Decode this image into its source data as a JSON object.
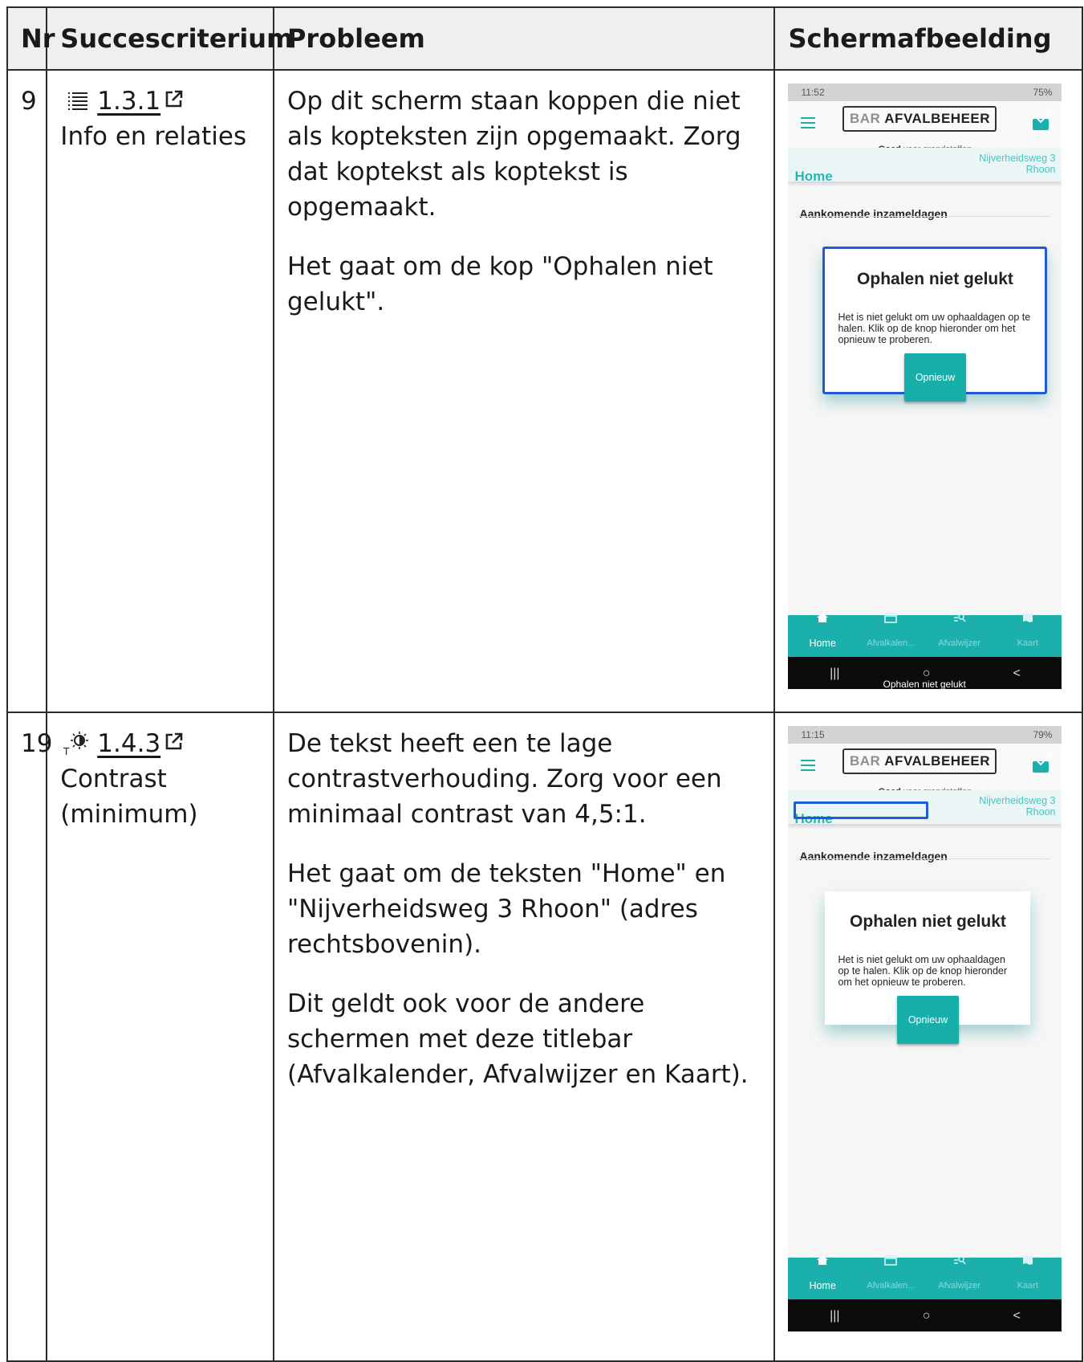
{
  "table": {
    "headers": [
      "Nr",
      "Succescriterium",
      "Probleem",
      "Schermafbeelding"
    ],
    "rows": [
      {
        "nr": "9",
        "criterion_icon": "list-icon",
        "criterion_code": "1.3.1",
        "criterion_name": "Info en relaties",
        "problem": [
          "Op dit scherm staan koppen die niet als kopteksten zijn opgemaakt. Zorg dat koptekst als koptekst is opgemaakt.",
          "Het gaat om de kop \"Ophalen niet gelukt\"."
        ],
        "screenshot": {
          "time": "11:52",
          "battery": "75%",
          "logo_bar": "BAR",
          "logo_name": "AFVALBEHEER",
          "tagline_bold": "Goed",
          "tagline_rest": "voor grondstoffen",
          "title": "Home",
          "address_line1": "Nijverheidsweg 3",
          "address_line2": "Rhoon",
          "section": "Aankomende inzameldagen",
          "dialog_title": "Ophalen niet gelukt",
          "dialog_body": "Het is niet gelukt om uw ophaaldagen op te halen. Klik op de knop hieronder om het opnieuw te proberen.",
          "dialog_button": "Opnieuw",
          "nav": [
            "Home",
            "Afvalkalen...",
            "Afvalwijzer",
            "Kaart"
          ],
          "caption": "Ophalen niet gelukt"
        }
      },
      {
        "nr": "19",
        "criterion_icon": "contrast-icon",
        "criterion_code": "1.4.3",
        "criterion_name_line1": "Contrast",
        "criterion_name_line2": "(minimum)",
        "problem": [
          "De tekst heeft een te lage contrastverhouding. Zorg voor een minimaal contrast van 4,5:1.",
          "Het gaat om de teksten \"Home\" en \"Nijverheidsweg 3 Rhoon\" (adres rechtsbovenin).",
          "Dit geldt ook voor de andere schermen met deze titlebar (Afvalkalender, Afvalwijzer en Kaart)."
        ],
        "screenshot": {
          "time": "11:15",
          "battery": "79%",
          "logo_bar": "BAR",
          "logo_name": "AFVALBEHEER",
          "tagline_bold": "Goed",
          "tagline_rest": "voor grondstoffen",
          "title": "Home",
          "address_line1": "Nijverheidsweg 3",
          "address_line2": "Rhoon",
          "section": "Aankomende inzameldagen",
          "dialog_title": "Ophalen niet gelukt",
          "dialog_body": "Het is niet gelukt om uw ophaaldagen op te halen. Klik op de knop hieronder om het opnieuw te proberen.",
          "dialog_button": "Opnieuw",
          "nav": [
            "Home",
            "Afvalkalen...",
            "Afvalwijzer",
            "Kaart"
          ]
        }
      }
    ]
  },
  "colors": {
    "accent_teal": "#1cb0ad",
    "focus_blue": "#1f5bd6",
    "header_bg": "#efefef"
  }
}
